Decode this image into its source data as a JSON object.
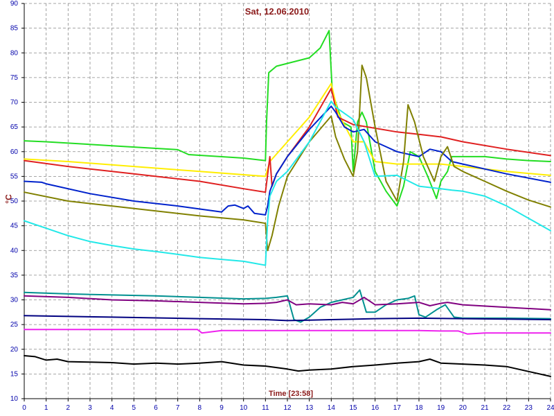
{
  "chart_data": {
    "type": "line",
    "title": "Sat, 12.06.2010",
    "xlabel": "Time [23:58]",
    "ylabel": "°C",
    "xlim": [
      0,
      24
    ],
    "ylim": [
      10,
      90
    ],
    "x_ticks": [
      0,
      1,
      2,
      3,
      4,
      5,
      6,
      7,
      8,
      9,
      10,
      11,
      12,
      13,
      14,
      15,
      16,
      17,
      18,
      19,
      20,
      21,
      22,
      23,
      24
    ],
    "y_ticks": [
      10,
      15,
      20,
      25,
      30,
      35,
      40,
      45,
      50,
      55,
      60,
      65,
      70,
      75,
      80,
      85,
      90
    ],
    "grid": true,
    "legend": "none",
    "series": [
      {
        "color": "#22dd22",
        "points": [
          [
            0,
            62.2
          ],
          [
            1,
            62
          ],
          [
            4,
            61.2
          ],
          [
            7,
            60.4
          ],
          [
            7.5,
            59.4
          ],
          [
            10,
            58.7
          ],
          [
            11,
            58.2
          ],
          [
            11.05,
            66
          ],
          [
            11.15,
            76
          ],
          [
            11.5,
            77.3
          ],
          [
            13,
            79
          ],
          [
            13.5,
            81
          ],
          [
            13.9,
            84.5
          ],
          [
            14.05,
            72
          ],
          [
            14.5,
            66
          ],
          [
            14.9,
            65
          ],
          [
            15,
            56
          ],
          [
            15.2,
            66
          ],
          [
            15.4,
            68
          ],
          [
            15.6,
            66
          ],
          [
            16,
            56
          ],
          [
            16.5,
            52
          ],
          [
            17,
            49
          ],
          [
            17.3,
            53
          ],
          [
            17.6,
            60
          ],
          [
            18,
            59
          ],
          [
            18.4,
            55
          ],
          [
            18.8,
            50.5
          ],
          [
            19,
            54
          ],
          [
            19.3,
            56
          ],
          [
            19.5,
            59
          ],
          [
            20,
            59
          ],
          [
            21,
            59
          ],
          [
            22,
            58.5
          ],
          [
            23,
            58.2
          ],
          [
            24,
            58
          ]
        ]
      },
      {
        "color": "#ffee00",
        "points": [
          [
            0,
            58.5
          ],
          [
            2,
            58
          ],
          [
            5,
            57
          ],
          [
            8,
            56
          ],
          [
            11,
            55
          ],
          [
            11.2,
            58
          ],
          [
            12,
            62
          ],
          [
            13,
            67
          ],
          [
            14,
            73.8
          ],
          [
            14.3,
            68
          ],
          [
            15,
            62
          ],
          [
            15.5,
            62
          ],
          [
            16,
            58
          ],
          [
            17,
            57.5
          ],
          [
            18,
            57.5
          ],
          [
            19,
            57.5
          ],
          [
            20,
            57
          ],
          [
            22,
            56
          ],
          [
            24,
            55.2
          ]
        ]
      },
      {
        "color": "#e02020",
        "points": [
          [
            0,
            58.2
          ],
          [
            2,
            57
          ],
          [
            5,
            55.5
          ],
          [
            8,
            54
          ],
          [
            10,
            52.5
          ],
          [
            11,
            51.8
          ],
          [
            11.2,
            59
          ],
          [
            11.3,
            53
          ],
          [
            11.5,
            55.5
          ],
          [
            12,
            59
          ],
          [
            13,
            65
          ],
          [
            14,
            72.8
          ],
          [
            14.3,
            67
          ],
          [
            15,
            65.5
          ],
          [
            17,
            64
          ],
          [
            18,
            63.5
          ],
          [
            19,
            63
          ],
          [
            20,
            62
          ],
          [
            22,
            60.5
          ],
          [
            24,
            59.2
          ]
        ]
      },
      {
        "color": "#0022cc",
        "points": [
          [
            0,
            54
          ],
          [
            0.8,
            53.8
          ],
          [
            1,
            53.5
          ],
          [
            3,
            51.5
          ],
          [
            5,
            50
          ],
          [
            7,
            49
          ],
          [
            9,
            47.8
          ],
          [
            9.3,
            49
          ],
          [
            9.6,
            49.2
          ],
          [
            10,
            48.5
          ],
          [
            10.2,
            49
          ],
          [
            10.5,
            47.5
          ],
          [
            11,
            47.2
          ],
          [
            11.1,
            49
          ],
          [
            11.2,
            52
          ],
          [
            11.5,
            55.5
          ],
          [
            12,
            59
          ],
          [
            13,
            64.5
          ],
          [
            14,
            69.2
          ],
          [
            14.2,
            68
          ],
          [
            14.6,
            65
          ],
          [
            15,
            64
          ],
          [
            15.5,
            64.5
          ],
          [
            16,
            62
          ],
          [
            16.5,
            61
          ],
          [
            17,
            60
          ],
          [
            17.5,
            59.5
          ],
          [
            18,
            59
          ],
          [
            18.5,
            60.5
          ],
          [
            19,
            60
          ],
          [
            19.5,
            58
          ],
          [
            20,
            57.5
          ],
          [
            22,
            55.5
          ],
          [
            24,
            53.8
          ]
        ]
      },
      {
        "color": "#808000",
        "points": [
          [
            0,
            51.8
          ],
          [
            2,
            50
          ],
          [
            4,
            49
          ],
          [
            6,
            48
          ],
          [
            8,
            47
          ],
          [
            10,
            46.2
          ],
          [
            11,
            45.5
          ],
          [
            11.1,
            40
          ],
          [
            11.3,
            43
          ],
          [
            11.6,
            49
          ],
          [
            12,
            55
          ],
          [
            13,
            62
          ],
          [
            14,
            67.2
          ],
          [
            14.2,
            63
          ],
          [
            14.6,
            58.5
          ],
          [
            15,
            55
          ],
          [
            15.2,
            60
          ],
          [
            15.4,
            77.5
          ],
          [
            15.6,
            75
          ],
          [
            16,
            65
          ],
          [
            16.5,
            54
          ],
          [
            17,
            50
          ],
          [
            17.3,
            58
          ],
          [
            17.5,
            69.5
          ],
          [
            17.8,
            66
          ],
          [
            18.2,
            59
          ],
          [
            18.7,
            54
          ],
          [
            19,
            59
          ],
          [
            19.3,
            61
          ],
          [
            19.6,
            57
          ],
          [
            20,
            56
          ],
          [
            21,
            54
          ],
          [
            22,
            52
          ],
          [
            23,
            50.2
          ],
          [
            24,
            48.8
          ]
        ]
      },
      {
        "color": "#22e8e8",
        "points": [
          [
            0,
            46
          ],
          [
            1,
            44.5
          ],
          [
            2,
            43
          ],
          [
            3,
            41.8
          ],
          [
            4,
            41
          ],
          [
            5,
            40.3
          ],
          [
            6,
            39.8
          ],
          [
            7,
            39.2
          ],
          [
            8,
            38.6
          ],
          [
            9,
            38.2
          ],
          [
            10,
            37.8
          ],
          [
            11,
            37
          ],
          [
            11.1,
            46
          ],
          [
            11.2,
            51
          ],
          [
            11.5,
            54
          ],
          [
            12,
            56
          ],
          [
            13,
            62
          ],
          [
            14,
            70.2
          ],
          [
            14.2,
            69
          ],
          [
            15,
            66.5
          ],
          [
            15.5,
            62
          ],
          [
            16,
            55
          ],
          [
            17,
            55.2
          ],
          [
            18,
            53
          ],
          [
            19,
            52.5
          ],
          [
            19.5,
            52.2
          ],
          [
            20,
            52
          ],
          [
            21,
            51
          ],
          [
            22,
            49
          ],
          [
            23,
            46.5
          ],
          [
            24,
            44
          ]
        ]
      },
      {
        "color": "#009090",
        "points": [
          [
            0,
            31.5
          ],
          [
            2,
            31.2
          ],
          [
            4,
            31
          ],
          [
            6,
            30.8
          ],
          [
            8,
            30.5
          ],
          [
            10,
            30.2
          ],
          [
            11,
            30.3
          ],
          [
            11.5,
            30.5
          ],
          [
            12,
            30.8
          ],
          [
            12.3,
            26
          ],
          [
            12.6,
            25.5
          ],
          [
            13,
            26.5
          ],
          [
            13.5,
            28.5
          ],
          [
            14,
            29.5
          ],
          [
            14.5,
            30
          ],
          [
            15,
            30.5
          ],
          [
            15.3,
            32
          ],
          [
            15.6,
            27.5
          ],
          [
            16,
            27.5
          ],
          [
            16.5,
            29
          ],
          [
            17,
            30
          ],
          [
            17.5,
            30.3
          ],
          [
            17.8,
            30.8
          ],
          [
            18,
            27
          ],
          [
            18.3,
            26.5
          ],
          [
            18.8,
            28
          ],
          [
            19.2,
            29
          ],
          [
            19.6,
            26.5
          ],
          [
            20,
            26.3
          ],
          [
            22,
            26.3
          ],
          [
            24,
            26.2
          ]
        ]
      },
      {
        "color": "#800080",
        "points": [
          [
            0,
            30.8
          ],
          [
            2,
            30.5
          ],
          [
            4,
            30
          ],
          [
            6,
            29.8
          ],
          [
            8,
            29.5
          ],
          [
            10,
            29.2
          ],
          [
            11,
            29.3
          ],
          [
            11.5,
            29.5
          ],
          [
            12,
            30
          ],
          [
            12.4,
            29
          ],
          [
            13,
            29.2
          ],
          [
            14,
            29
          ],
          [
            14.5,
            29.5
          ],
          [
            15,
            29.2
          ],
          [
            15.5,
            30.5
          ],
          [
            16,
            29
          ],
          [
            17,
            29.2
          ],
          [
            18,
            29.5
          ],
          [
            18.5,
            28.8
          ],
          [
            19,
            29.3
          ],
          [
            19.3,
            29.5
          ],
          [
            20,
            29
          ],
          [
            22,
            28.5
          ],
          [
            24,
            28
          ]
        ]
      },
      {
        "color": "#000080",
        "points": [
          [
            0,
            26.8
          ],
          [
            4,
            26.5
          ],
          [
            8,
            26.2
          ],
          [
            11,
            26
          ],
          [
            12,
            25.8
          ],
          [
            13,
            25.9
          ],
          [
            14,
            26
          ],
          [
            16,
            26.2
          ],
          [
            18,
            26.3
          ],
          [
            20,
            26.2
          ],
          [
            22,
            26.1
          ],
          [
            24,
            26
          ]
        ]
      },
      {
        "color": "#ee22ee",
        "points": [
          [
            0,
            24
          ],
          [
            4,
            24
          ],
          [
            7.9,
            24
          ],
          [
            8.1,
            23.3
          ],
          [
            9,
            23.8
          ],
          [
            12,
            23.8
          ],
          [
            16,
            23.8
          ],
          [
            18,
            23.8
          ],
          [
            19,
            23.7
          ],
          [
            19.8,
            23.7
          ],
          [
            20.2,
            23.1
          ],
          [
            21,
            23.3
          ],
          [
            24,
            23.3
          ]
        ]
      },
      {
        "color": "#000000",
        "points": [
          [
            0,
            18.7
          ],
          [
            0.5,
            18.5
          ],
          [
            1,
            17.8
          ],
          [
            1.5,
            18
          ],
          [
            2,
            17.5
          ],
          [
            3,
            17.4
          ],
          [
            4,
            17.3
          ],
          [
            5,
            17
          ],
          [
            6,
            17.2
          ],
          [
            7,
            17
          ],
          [
            8,
            17.2
          ],
          [
            9,
            17.5
          ],
          [
            10,
            16.8
          ],
          [
            11,
            16.6
          ],
          [
            12,
            16
          ],
          [
            12.5,
            15.6
          ],
          [
            13,
            15.8
          ],
          [
            14,
            16
          ],
          [
            15,
            16.5
          ],
          [
            16,
            16.8
          ],
          [
            17,
            17.2
          ],
          [
            18,
            17.5
          ],
          [
            18.5,
            18
          ],
          [
            19,
            17.2
          ],
          [
            20,
            17
          ],
          [
            21,
            16.8
          ],
          [
            22,
            16.5
          ],
          [
            23,
            15.5
          ],
          [
            24,
            14.5
          ]
        ]
      }
    ]
  }
}
